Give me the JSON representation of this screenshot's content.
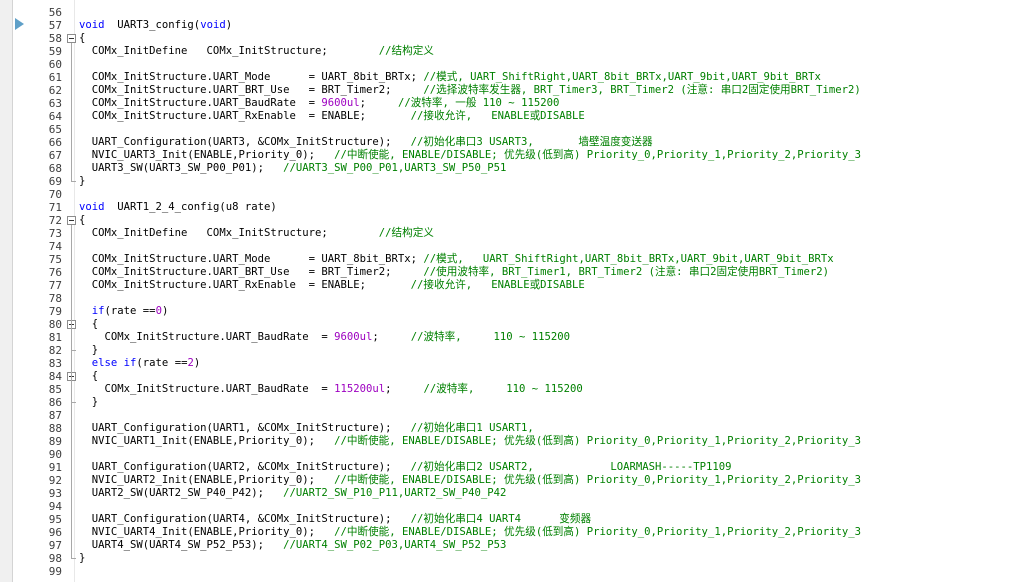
{
  "colors": {
    "keyword": "#0000ff",
    "number": "#9d00c0",
    "comment": "#008000",
    "text": "#000000",
    "line_number": "#3c3c3c",
    "breakpoint_marker": "#5fa0c8"
  },
  "editor": {
    "current_line": 57,
    "lines": [
      {
        "n": "56",
        "tokens": []
      },
      {
        "n": "57",
        "tokens": [
          {
            "t": "kw",
            "v": "void"
          },
          {
            "t": "tx",
            "v": "  UART3_config("
          },
          {
            "t": "kw",
            "v": "void"
          },
          {
            "t": "tx",
            "v": ")"
          }
        ]
      },
      {
        "n": "58",
        "tokens": [
          {
            "t": "tx",
            "v": "{"
          }
        ]
      },
      {
        "n": "59",
        "tokens": [
          {
            "t": "tx",
            "v": "  COMx_InitDefine   COMx_InitStructure;        "
          },
          {
            "t": "cm",
            "v": "//结构定义"
          }
        ]
      },
      {
        "n": "60",
        "tokens": []
      },
      {
        "n": "61",
        "tokens": [
          {
            "t": "tx",
            "v": "  COMx_InitStructure.UART_Mode      = UART_8bit_BRTx; "
          },
          {
            "t": "cm",
            "v": "//模式, UART_ShiftRight,UART_8bit_BRTx,UART_9bit,UART_9bit_BRTx"
          }
        ]
      },
      {
        "n": "62",
        "tokens": [
          {
            "t": "tx",
            "v": "  COMx_InitStructure.UART_BRT_Use   = BRT_Timer2;     "
          },
          {
            "t": "cm",
            "v": "//选择波特率发生器, BRT_Timer3, BRT_Timer2 (注意: 串口2固定使用BRT_Timer2)"
          }
        ]
      },
      {
        "n": "63",
        "tokens": [
          {
            "t": "tx",
            "v": "  COMx_InitStructure.UART_BaudRate  = "
          },
          {
            "t": "nm",
            "v": "9600ul"
          },
          {
            "t": "tx",
            "v": ";     "
          },
          {
            "t": "cm",
            "v": "//波特率, 一般 110 ~ 115200"
          }
        ]
      },
      {
        "n": "64",
        "tokens": [
          {
            "t": "tx",
            "v": "  COMx_InitStructure.UART_RxEnable  = ENABLE;       "
          },
          {
            "t": "cm",
            "v": "//接收允许,   ENABLE或DISABLE"
          }
        ]
      },
      {
        "n": "65",
        "tokens": []
      },
      {
        "n": "66",
        "tokens": [
          {
            "t": "tx",
            "v": "  UART_Configuration(UART3, &COMx_InitStructure);   "
          },
          {
            "t": "cm",
            "v": "//初始化串口3 USART3,       墙壁温度变送器"
          }
        ]
      },
      {
        "n": "67",
        "tokens": [
          {
            "t": "tx",
            "v": "  NVIC_UART3_Init(ENABLE,Priority_0);   "
          },
          {
            "t": "cm",
            "v": "//中断使能, ENABLE/DISABLE; 优先级(低到高) Priority_0,Priority_1,Priority_2,Priority_3"
          }
        ]
      },
      {
        "n": "68",
        "tokens": [
          {
            "t": "tx",
            "v": "  UART3_SW(UART3_SW_P00_P01);   "
          },
          {
            "t": "cm",
            "v": "//UART3_SW_P00_P01,UART3_SW_P50_P51"
          }
        ]
      },
      {
        "n": "69",
        "tokens": [
          {
            "t": "tx",
            "v": "}"
          }
        ]
      },
      {
        "n": "70",
        "tokens": []
      },
      {
        "n": "71",
        "tokens": [
          {
            "t": "kw",
            "v": "void"
          },
          {
            "t": "tx",
            "v": "  UART1_2_4_config(u8 rate)"
          }
        ]
      },
      {
        "n": "72",
        "tokens": [
          {
            "t": "tx",
            "v": "{"
          }
        ]
      },
      {
        "n": "73",
        "tokens": [
          {
            "t": "tx",
            "v": "  COMx_InitDefine   COMx_InitStructure;        "
          },
          {
            "t": "cm",
            "v": "//结构定义"
          }
        ]
      },
      {
        "n": "74",
        "tokens": []
      },
      {
        "n": "75",
        "tokens": [
          {
            "t": "tx",
            "v": "  COMx_InitStructure.UART_Mode      = UART_8bit_BRTx; "
          },
          {
            "t": "cm",
            "v": "//模式,   UART_ShiftRight,UART_8bit_BRTx,UART_9bit,UART_9bit_BRTx"
          }
        ]
      },
      {
        "n": "76",
        "tokens": [
          {
            "t": "tx",
            "v": "  COMx_InitStructure.UART_BRT_Use   = BRT_Timer2;     "
          },
          {
            "t": "cm",
            "v": "//使用波特率, BRT_Timer1, BRT_Timer2 (注意: 串口2固定使用BRT_Timer2)"
          }
        ]
      },
      {
        "n": "77",
        "tokens": [
          {
            "t": "tx",
            "v": "  COMx_InitStructure.UART_RxEnable  = ENABLE;       "
          },
          {
            "t": "cm",
            "v": "//接收允许,   ENABLE或DISABLE"
          }
        ]
      },
      {
        "n": "78",
        "tokens": []
      },
      {
        "n": "79",
        "tokens": [
          {
            "t": "tx",
            "v": "  "
          },
          {
            "t": "kw",
            "v": "if"
          },
          {
            "t": "tx",
            "v": "(rate =="
          },
          {
            "t": "nm",
            "v": "0"
          },
          {
            "t": "tx",
            "v": ")"
          }
        ]
      },
      {
        "n": "80",
        "tokens": [
          {
            "t": "tx",
            "v": "  {"
          }
        ]
      },
      {
        "n": "81",
        "tokens": [
          {
            "t": "tx",
            "v": "    COMx_InitStructure.UART_BaudRate  = "
          },
          {
            "t": "nm",
            "v": "9600ul"
          },
          {
            "t": "tx",
            "v": ";     "
          },
          {
            "t": "cm",
            "v": "//波特率,     110 ~ 115200"
          }
        ]
      },
      {
        "n": "82",
        "tokens": [
          {
            "t": "tx",
            "v": "  }"
          }
        ]
      },
      {
        "n": "83",
        "tokens": [
          {
            "t": "tx",
            "v": "  "
          },
          {
            "t": "kw",
            "v": "else if"
          },
          {
            "t": "tx",
            "v": "(rate =="
          },
          {
            "t": "nm",
            "v": "2"
          },
          {
            "t": "tx",
            "v": ")"
          }
        ]
      },
      {
        "n": "84",
        "tokens": [
          {
            "t": "tx",
            "v": "  {"
          }
        ]
      },
      {
        "n": "85",
        "tokens": [
          {
            "t": "tx",
            "v": "    COMx_InitStructure.UART_BaudRate  = "
          },
          {
            "t": "nm",
            "v": "115200ul"
          },
          {
            "t": "tx",
            "v": ";     "
          },
          {
            "t": "cm",
            "v": "//波特率,     110 ~ 115200"
          }
        ]
      },
      {
        "n": "86",
        "tokens": [
          {
            "t": "tx",
            "v": "  }"
          }
        ]
      },
      {
        "n": "87",
        "tokens": []
      },
      {
        "n": "88",
        "tokens": [
          {
            "t": "tx",
            "v": "  UART_Configuration(UART1, &COMx_InitStructure);   "
          },
          {
            "t": "cm",
            "v": "//初始化串口1 USART1,"
          }
        ]
      },
      {
        "n": "89",
        "tokens": [
          {
            "t": "tx",
            "v": "  NVIC_UART1_Init(ENABLE,Priority_0);   "
          },
          {
            "t": "cm",
            "v": "//中断使能, ENABLE/DISABLE; 优先级(低到高) Priority_0,Priority_1,Priority_2,Priority_3"
          }
        ]
      },
      {
        "n": "90",
        "tokens": []
      },
      {
        "n": "91",
        "tokens": [
          {
            "t": "tx",
            "v": "  UART_Configuration(UART2, &COMx_InitStructure);   "
          },
          {
            "t": "cm",
            "v": "//初始化串口2 USART2,            LOARMASH-----TP1109"
          }
        ]
      },
      {
        "n": "92",
        "tokens": [
          {
            "t": "tx",
            "v": "  NVIC_UART2_Init(ENABLE,Priority_0);   "
          },
          {
            "t": "cm",
            "v": "//中断使能, ENABLE/DISABLE; 优先级(低到高) Priority_0,Priority_1,Priority_2,Priority_3"
          }
        ]
      },
      {
        "n": "93",
        "tokens": [
          {
            "t": "tx",
            "v": "  UART2_SW(UART2_SW_P40_P42);   "
          },
          {
            "t": "cm",
            "v": "//UART2_SW_P10_P11,UART2_SW_P40_P42"
          }
        ]
      },
      {
        "n": "94",
        "tokens": []
      },
      {
        "n": "95",
        "tokens": [
          {
            "t": "tx",
            "v": "  UART_Configuration(UART4, &COMx_InitStructure);   "
          },
          {
            "t": "cm",
            "v": "//初始化串口4 UART4      变频器"
          }
        ]
      },
      {
        "n": "96",
        "tokens": [
          {
            "t": "tx",
            "v": "  NVIC_UART4_Init(ENABLE,Priority_0);   "
          },
          {
            "t": "cm",
            "v": "//中断使能, ENABLE/DISABLE; 优先级(低到高) Priority_0,Priority_1,Priority_2,Priority_3"
          }
        ]
      },
      {
        "n": "97",
        "tokens": [
          {
            "t": "tx",
            "v": "  UART4_SW(UART4_SW_P52_P53);   "
          },
          {
            "t": "cm",
            "v": "//UART4_SW_P02_P03,UART4_SW_P52_P53"
          }
        ]
      },
      {
        "n": "98",
        "tokens": [
          {
            "t": "tx",
            "v": "}"
          }
        ]
      },
      {
        "n": "99",
        "tokens": []
      }
    ]
  }
}
